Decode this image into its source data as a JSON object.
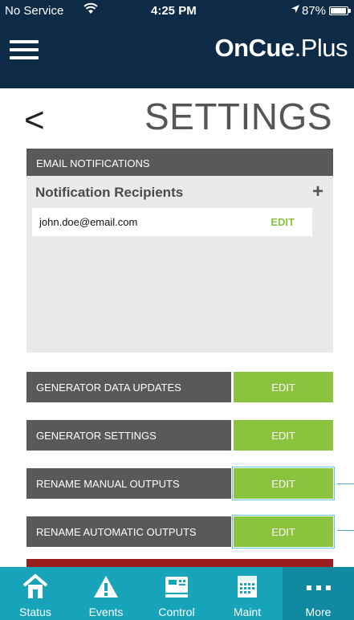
{
  "status_bar": {
    "carrier": "No Service",
    "wifi_icon": "wifi-icon",
    "time": "4:25 PM",
    "location_icon": "location-arrow-icon",
    "battery": "87%"
  },
  "header": {
    "menu_icon": "hamburger-menu-icon",
    "brand_bold": "OnCue",
    "brand_light": ".Plus",
    "bg_color": "#0d2a47"
  },
  "page": {
    "back_icon": "chevron-left-icon",
    "back_glyph": "<",
    "title": "SETTINGS"
  },
  "email_notifications": {
    "section_label": "EMAIL NOTIFICATIONS",
    "recipients_title": "Notification Recipients",
    "add_glyph": "+",
    "recipients": [
      {
        "email": "john.doe@email.com",
        "edit_label": "EDIT"
      }
    ]
  },
  "settings_rows": [
    {
      "label": "GENERATOR DATA UPDATES",
      "button": "EDIT"
    },
    {
      "label": "GENERATOR SETTINGS",
      "button": "EDIT"
    },
    {
      "label": "RENAME MANUAL OUTPUTS",
      "button": "EDIT"
    },
    {
      "label": "RENAME AUTOMATIC OUTPUTS",
      "button": "EDIT"
    }
  ],
  "tabbar": {
    "tabs": [
      {
        "label": "Status",
        "icon": "home-icon"
      },
      {
        "label": "Events",
        "icon": "warning-icon"
      },
      {
        "label": "Control",
        "icon": "controller-icon"
      },
      {
        "label": "Maint",
        "icon": "calendar-icon"
      },
      {
        "label": "More",
        "icon": "more-dots-icon"
      }
    ],
    "active": "More"
  },
  "colors": {
    "accent_green": "#8ac43f",
    "row_gray": "#595959",
    "tabbar_teal": "#17a3ba"
  }
}
